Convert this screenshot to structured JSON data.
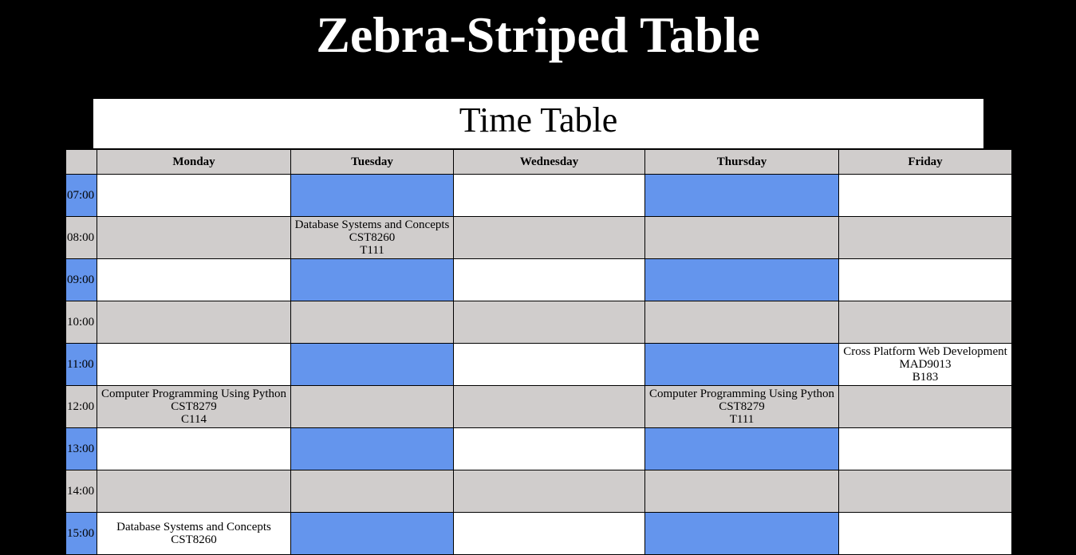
{
  "page": {
    "heading": "Zebra-Striped Table"
  },
  "table": {
    "caption": "Time Table",
    "columns": [
      "",
      "Monday",
      "Tuesday",
      "Wednesday",
      "Thursday",
      "Friday"
    ],
    "rows": [
      {
        "time": "07:00",
        "cells": [
          null,
          null,
          null,
          null,
          null
        ]
      },
      {
        "time": "08:00",
        "cells": [
          null,
          {
            "course": "Database Systems and Concepts",
            "code": "CST8260",
            "room": "T111"
          },
          null,
          null,
          null
        ]
      },
      {
        "time": "09:00",
        "cells": [
          null,
          null,
          null,
          null,
          null
        ]
      },
      {
        "time": "10:00",
        "cells": [
          null,
          null,
          null,
          null,
          null
        ]
      },
      {
        "time": "11:00",
        "cells": [
          null,
          null,
          null,
          null,
          {
            "course": "Cross Platform Web Development",
            "code": "MAD9013",
            "room": "B183"
          }
        ]
      },
      {
        "time": "12:00",
        "cells": [
          {
            "course": "Computer Programming Using Python",
            "code": "CST8279",
            "room": "C114"
          },
          null,
          null,
          {
            "course": "Computer Programming Using Python",
            "code": "CST8279",
            "room": "T111"
          },
          null
        ]
      },
      {
        "time": "13:00",
        "cells": [
          null,
          null,
          null,
          null,
          null
        ]
      },
      {
        "time": "14:00",
        "cells": [
          null,
          null,
          null,
          null,
          null
        ]
      },
      {
        "time": "15:00",
        "cells": [
          {
            "course": "Database Systems and Concepts",
            "code": "CST8260",
            "room": ""
          },
          null,
          null,
          null,
          null
        ]
      }
    ]
  },
  "colors": {
    "background": "#000000",
    "stripe_light": "#ffffff",
    "stripe_gray": "#d0cdcc",
    "accent_blue": "#6495ed"
  }
}
